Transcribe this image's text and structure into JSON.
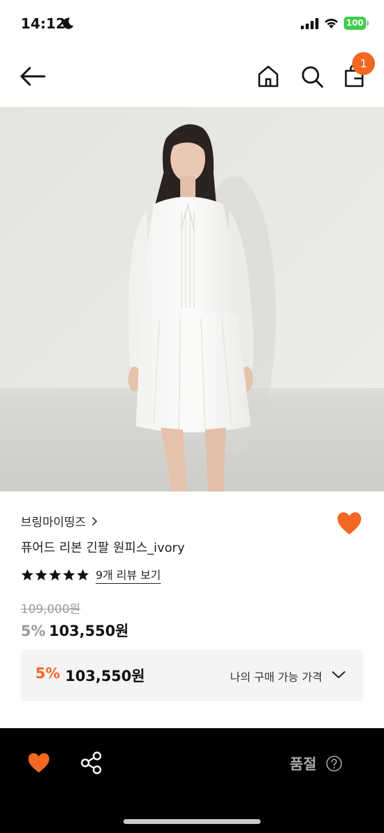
{
  "status_bar": {
    "time": "14:12",
    "battery": "100"
  },
  "header": {
    "cart_badge": "1"
  },
  "product": {
    "brand": "브링마이띵즈",
    "name": "퓨어드 리본 긴팔 원피스_ivory",
    "rating_stars": 5,
    "review_link": "9개 리뷰 보기",
    "original_price": "109,000원",
    "discount_rate": "5%",
    "sale_price": "103,550원"
  },
  "benefit": {
    "discount_rate": "5%",
    "price": "103,550원",
    "label": "나의 구매 가능 가격"
  },
  "bottom_bar": {
    "status": "품절"
  },
  "colors": {
    "accent": "#f26722",
    "battery": "#3ecf4a",
    "bottom_bar": "#000000",
    "muted": "#9a9a9a"
  },
  "icons": [
    "moon-icon",
    "signal-icon",
    "wifi-icon",
    "battery-icon",
    "back-arrow-icon",
    "home-icon",
    "search-icon",
    "cart-icon",
    "chevron-right-icon",
    "heart-icon",
    "star-icon",
    "chevron-down-icon",
    "share-icon",
    "help-icon"
  ]
}
